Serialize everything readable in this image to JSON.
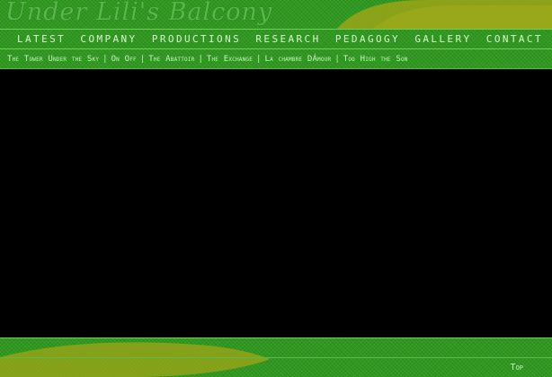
{
  "header": {
    "title": "Under Lili's Balcony"
  },
  "main_nav": [
    {
      "label": "LATEST"
    },
    {
      "label": "COMPANY"
    },
    {
      "label": "PRODUCTIONS"
    },
    {
      "label": "RESEARCH"
    },
    {
      "label": "PEDAGOGY"
    },
    {
      "label": "GALLERY"
    },
    {
      "label": "CONTACT"
    }
  ],
  "sub_nav": [
    {
      "label": "The Tower Under the Sky"
    },
    {
      "label": "On Off"
    },
    {
      "label": "The Abattoir"
    },
    {
      "label": "The Exchange"
    },
    {
      "label": "La chambre DÁmour"
    },
    {
      "label": "Too High the Son"
    }
  ],
  "sub_nav_separator": "|",
  "footer": {
    "top_link": "Top"
  },
  "colors": {
    "band_green": "#2f9a1f",
    "blob_olive": "#9aa418",
    "nav_text": "#d9f7d0",
    "content_bg": "#000000"
  }
}
